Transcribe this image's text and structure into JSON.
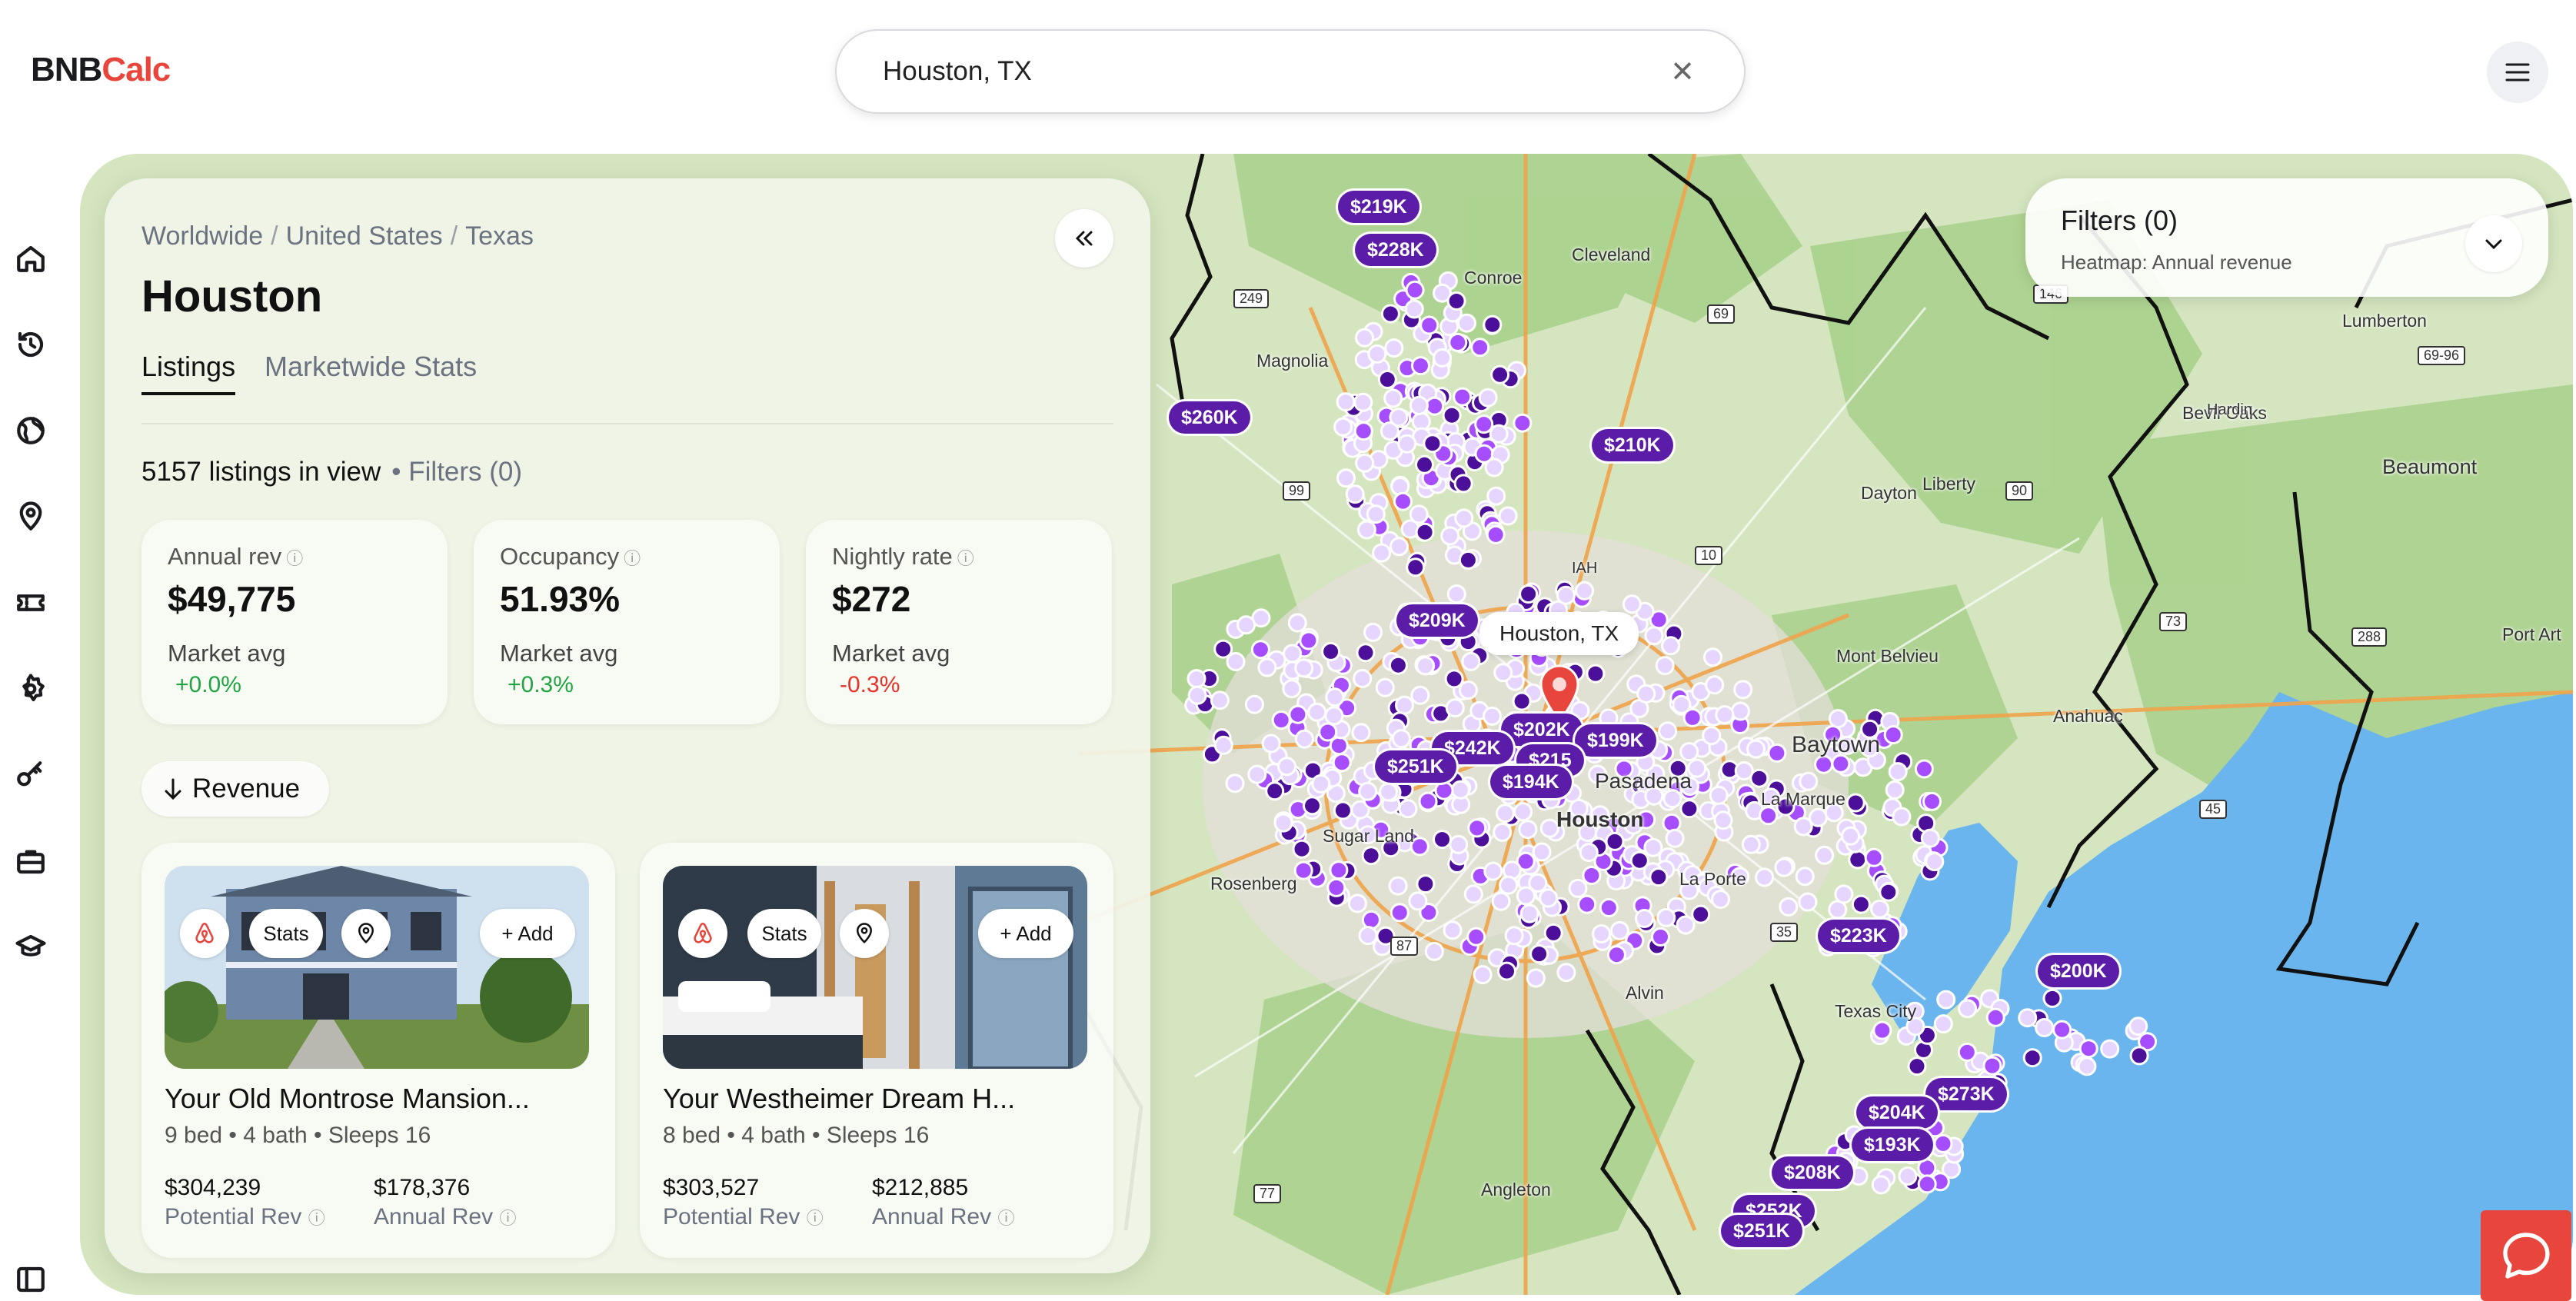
{
  "app": {
    "logo_part1": "BNB",
    "logo_part2": "Calc"
  },
  "search": {
    "value": "Houston, TX",
    "clear_icon": "close-icon"
  },
  "rail": {
    "icons": [
      "home-icon",
      "history-icon",
      "globe-icon",
      "location-pin-icon",
      "ticket-icon",
      "settings-icon",
      "key-icon",
      "briefcase-icon",
      "graduation-cap-icon",
      "sidebar-toggle-icon"
    ]
  },
  "panel": {
    "breadcrumb": [
      "Worldwide",
      "United States",
      "Texas"
    ],
    "city": "Houston",
    "tabs": [
      "Listings",
      "Marketwide Stats"
    ],
    "listing_count": "5157 listings in view",
    "filters_label": "• Filters (0)",
    "stats": [
      {
        "label": "Annual rev",
        "value": "$49,775",
        "market": "Market avg",
        "delta": "+0.0%",
        "trend": "pos"
      },
      {
        "label": "Occupancy",
        "value": "51.93%",
        "market": "Market avg",
        "delta": "+0.3%",
        "trend": "pos"
      },
      {
        "label": "Nightly rate",
        "value": "$272",
        "market": "Market avg",
        "delta": "-0.3%",
        "trend": "neg"
      }
    ],
    "sort_label": "Revenue",
    "card_chips": {
      "stats": "Stats",
      "add": "+ Add"
    },
    "listings": [
      {
        "title": "Your Old Montrose Mansion...",
        "meta": "9 bed • 4 bath • Sleeps 16",
        "potential_rev": "$304,239",
        "potential_label": "Potential Rev",
        "annual_rev": "$178,376",
        "annual_label": "Annual Rev"
      },
      {
        "title": "Your Westheimer Dream H...",
        "meta": "8 bed • 4 bath • Sleeps 16",
        "potential_rev": "$303,527",
        "potential_label": "Potential Rev",
        "annual_rev": "$212,885",
        "annual_label": "Annual Rev"
      }
    ]
  },
  "filters": {
    "title": "Filters (0)",
    "subtitle": "Heatmap: Annual revenue"
  },
  "map": {
    "callout": "Houston, TX",
    "price_pins": [
      "$219K",
      "$228K",
      "$260K",
      "$210K",
      "$209K",
      "$202K",
      "$199K",
      "$242K",
      "$251K",
      "$215",
      "$194K",
      "$223K",
      "$200K",
      "$273K",
      "$204K",
      "$193K",
      "$208K",
      "$252K",
      "$251K"
    ],
    "place_labels": [
      "Cleveland",
      "Magnolia",
      "Liberty",
      "Dayton",
      "Mont Belvieu",
      "Anahuac",
      "Beaumont",
      "Bevil Oaks",
      "Lumberton",
      "Hardin",
      "Port Art",
      "Rosenberg",
      "Sugar Land",
      "Alvin",
      "Angleton",
      "Texas City",
      "La Marque",
      "Baytown",
      "La Porte",
      "Pasadena",
      "Houston",
      "Conroe",
      "IAH"
    ],
    "road_shields": [
      "249",
      "146",
      "69",
      "99",
      "90",
      "69-96",
      "10",
      "73",
      "45",
      "288",
      "35",
      "87",
      "77"
    ],
    "colors": {
      "land": "#d4e5bf",
      "forest": "#a7d08a",
      "water": "#6bb5ee",
      "boundary": "#111111",
      "pin": "#5b1ca8",
      "dot_light": "#e6d6ff",
      "dot_mid": "#a64dff",
      "dot_dark": "#4b0f99"
    }
  }
}
